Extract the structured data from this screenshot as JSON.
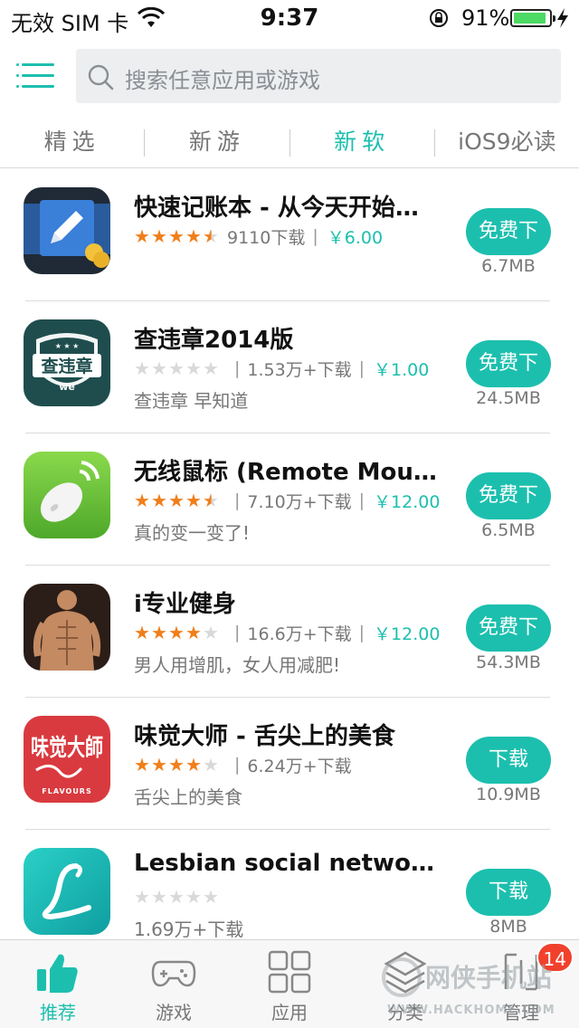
{
  "status": {
    "carrier": "无效 SIM 卡",
    "time": "9:37",
    "battery_pct": "91%",
    "battery_level": 0.91
  },
  "search": {
    "placeholder": "搜索任意应用或游戏"
  },
  "tabs": [
    {
      "label": "精选",
      "active": false
    },
    {
      "label": "新游",
      "active": false
    },
    {
      "label": "新软",
      "active": true
    },
    {
      "label": "iOS9必读",
      "active": false
    }
  ],
  "apps": [
    {
      "title": "快速记账本 - 从今天开始…",
      "rating": 4.5,
      "downloads": "9110下载",
      "price": "￥6.00",
      "subtitle": "",
      "button": "免费下",
      "size": "6.7MB"
    },
    {
      "title": "查违章2014版",
      "rating": 0,
      "downloads": "1.53万+下载",
      "price": "￥1.00",
      "subtitle": "查违章 早知道",
      "button": "免费下",
      "size": "24.5MB"
    },
    {
      "title": "无线鼠标 (Remote Mouse)",
      "rating": 4.5,
      "downloads": "7.10万+下载",
      "price": "￥12.00",
      "subtitle": "真的变一变了!",
      "button": "免费下",
      "size": "6.5MB"
    },
    {
      "title": "i专业健身",
      "rating": 4,
      "downloads": "16.6万+下载",
      "price": "￥12.00",
      "subtitle": "男人用增肌，女人用减肥!",
      "button": "免费下",
      "size": "54.3MB"
    },
    {
      "title": "味觉大师 - 舌尖上的美食",
      "rating": 4,
      "downloads": "6.24万+下载",
      "price": "",
      "subtitle": "舌尖上的美食",
      "button": "下载",
      "size": "10.9MB"
    },
    {
      "title": "Lesbian social network…",
      "rating": 0,
      "downloads": "",
      "price": "",
      "subtitle": "1.69万+下载",
      "button": "下载",
      "size": "8MB"
    }
  ],
  "app_icons": [
    {
      "name": "notebook-pencil-icon",
      "bg": "#1f2a36"
    },
    {
      "name": "shield-badge-icon",
      "bg": "#1f4d4d"
    },
    {
      "name": "mouse-icon",
      "bg": "#6cc638"
    },
    {
      "name": "fitness-torso-icon",
      "bg": "#3a2a22"
    },
    {
      "name": "calligraphy-icon",
      "bg": "#d93a3f"
    },
    {
      "name": "letter-l-icon",
      "bg": "#17b6b4"
    }
  ],
  "icon_texts": {
    "icon2_text": "查违章",
    "icon2_sub": "we",
    "icon5_text": "味觉大師",
    "icon5_sub": "FLAVOURS"
  },
  "nav": [
    {
      "label": "推荐",
      "icon": "thumbs-up-icon",
      "active": true,
      "badge": ""
    },
    {
      "label": "游戏",
      "icon": "gamepad-icon",
      "active": false,
      "badge": ""
    },
    {
      "label": "应用",
      "icon": "grid-icon",
      "active": false,
      "badge": ""
    },
    {
      "label": "分类",
      "icon": "category-icon",
      "active": false,
      "badge": ""
    },
    {
      "label": "管理",
      "icon": "manage-icon",
      "active": false,
      "badge": "14"
    }
  ],
  "watermark": {
    "text": "网侠手机站",
    "url_text": "WWW.HACKHOME.COM"
  },
  "colors": {
    "accent": "#1cbfae",
    "star": "#f07f1b",
    "badge": "#f0412d"
  }
}
